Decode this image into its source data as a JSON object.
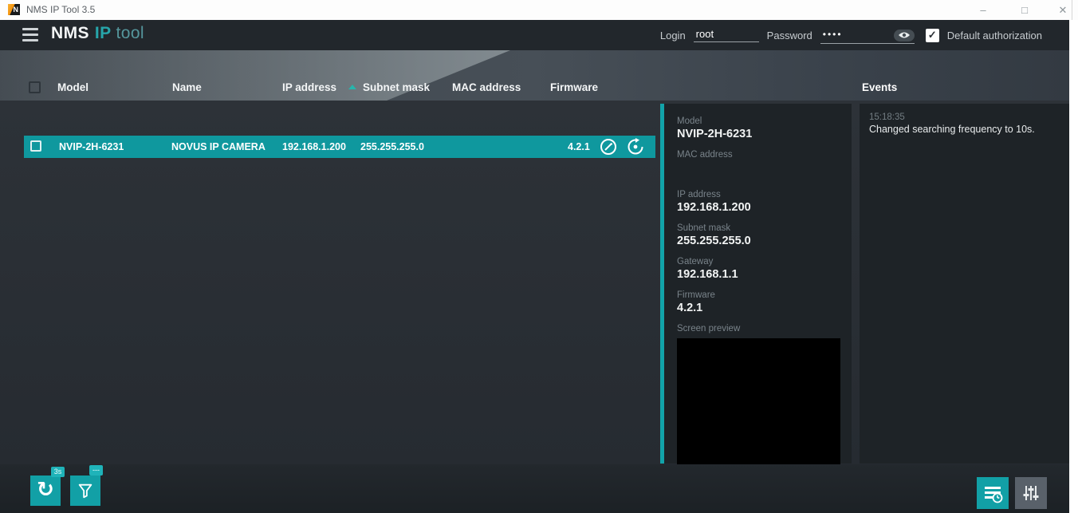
{
  "window": {
    "title": "NMS IP Tool 3.5",
    "minimize": "–",
    "maximize": "□",
    "close": "✕"
  },
  "header": {
    "logo": {
      "nms": "NMS",
      "ip": "IP",
      "tool": "tool"
    },
    "login_label": "Login",
    "login_value": "root",
    "password_label": "Password",
    "password_value": "••••",
    "default_auth_label": "Default authorization",
    "default_auth_checked": "✓"
  },
  "table": {
    "columns": [
      "Model",
      "Name",
      "IP address",
      "Subnet mask",
      "MAC address",
      "Firmware"
    ],
    "rows": [
      {
        "model": "NVIP-2H-6231",
        "name": "NOVUS IP CAMERA",
        "ip": "192.168.1.200",
        "subnet": "255.255.255.0",
        "mac": "",
        "firmware": "4.2.1"
      }
    ]
  },
  "details": {
    "fields": [
      {
        "label": "Model",
        "value": "NVIP-2H-6231"
      },
      {
        "label": "MAC address",
        "value": ""
      },
      {
        "label": "IP address",
        "value": "192.168.1.200"
      },
      {
        "label": "Subnet mask",
        "value": "255.255.255.0"
      },
      {
        "label": "Gateway",
        "value": "192.168.1.1"
      },
      {
        "label": "Firmware",
        "value": "4.2.1"
      }
    ],
    "preview_label": "Screen preview"
  },
  "events": {
    "title": "Events",
    "items": [
      {
        "time": "15:18:35",
        "message": "Changed searching frequency to 10s."
      }
    ]
  },
  "toolbar": {
    "refresh_badge": "3s",
    "filter_badge": "---",
    "refresh_glyph": "↻"
  },
  "colors": {
    "accent_teal": "#12a0a6",
    "accent_teal_bright": "#1fb3b9",
    "row_selected": "#0f989e",
    "panel_bg": "#1e2327",
    "app_bg": "#2b3036",
    "settings_button_bg": "#59616a"
  }
}
